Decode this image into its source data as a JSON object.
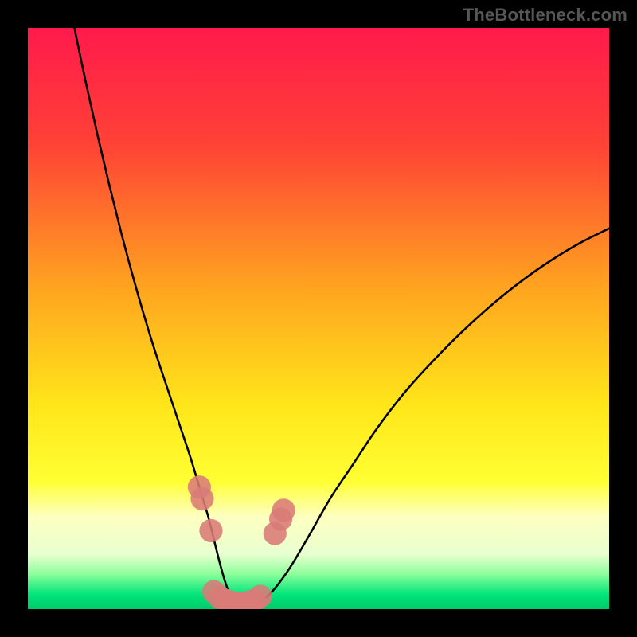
{
  "watermark": "TheBottleneck.com",
  "chart_data": {
    "type": "line",
    "title": "",
    "xlabel": "",
    "ylabel": "",
    "xlim": [
      0,
      100
    ],
    "ylim": [
      0,
      100
    ],
    "gradient_stops": [
      {
        "offset": 0,
        "color": "#ff1a4b"
      },
      {
        "offset": 0.2,
        "color": "#ff4236"
      },
      {
        "offset": 0.45,
        "color": "#ffa51f"
      },
      {
        "offset": 0.65,
        "color": "#ffe61a"
      },
      {
        "offset": 0.78,
        "color": "#ffff33"
      },
      {
        "offset": 0.84,
        "color": "#fdffbf"
      },
      {
        "offset": 0.905,
        "color": "#e9ffd0"
      },
      {
        "offset": 0.94,
        "color": "#8bff9b"
      },
      {
        "offset": 0.975,
        "color": "#00e57a"
      },
      {
        "offset": 1.0,
        "color": "#00c96a"
      }
    ],
    "series": [
      {
        "name": "bottleneck-curve",
        "x": [
          8.0,
          10.0,
          12.0,
          14.0,
          16.0,
          18.0,
          20.0,
          22.0,
          24.0,
          26.0,
          28.0,
          29.5,
          31.0,
          32.0,
          33.0,
          34.0,
          35.0,
          36.0,
          38.0,
          40.0,
          42.0,
          45.0,
          48.0,
          52.0,
          56.0,
          60.0,
          65.0,
          70.0,
          75.0,
          80.0,
          85.0,
          90.0,
          95.0,
          100.0
        ],
        "y": [
          100.0,
          90.5,
          81.5,
          73.0,
          65.0,
          57.5,
          50.5,
          44.0,
          38.0,
          32.0,
          26.0,
          21.0,
          16.0,
          12.0,
          8.0,
          4.5,
          2.0,
          1.0,
          1.0,
          1.5,
          3.0,
          7.0,
          12.0,
          19.0,
          25.0,
          31.0,
          37.5,
          43.0,
          48.0,
          52.5,
          56.5,
          60.0,
          63.0,
          65.5
        ]
      }
    ],
    "markers": {
      "name": "highlight-region",
      "color": "#d97b77",
      "radius": 2.0,
      "points": [
        {
          "x": 29.5,
          "y": 21.0
        },
        {
          "x": 30.0,
          "y": 19.0
        },
        {
          "x": 31.5,
          "y": 13.5
        },
        {
          "x": 32.0,
          "y": 3.0
        },
        {
          "x": 33.0,
          "y": 2.0
        },
        {
          "x": 34.0,
          "y": 1.5
        },
        {
          "x": 35.0,
          "y": 1.2
        },
        {
          "x": 36.0,
          "y": 1.0
        },
        {
          "x": 37.0,
          "y": 1.0
        },
        {
          "x": 38.0,
          "y": 1.2
        },
        {
          "x": 39.0,
          "y": 1.5
        },
        {
          "x": 40.0,
          "y": 2.2
        },
        {
          "x": 42.5,
          "y": 13.0
        },
        {
          "x": 43.5,
          "y": 15.5
        },
        {
          "x": 44.0,
          "y": 17.0
        }
      ]
    }
  }
}
